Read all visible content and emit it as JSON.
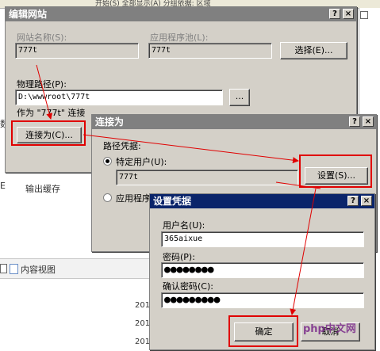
{
  "background": {
    "toolbar_text": "开始(S)   全部显示(A)  分组依据: 区域",
    "left_fragment": "数",
    "left_fragment2": "E",
    "actions_fragment": "输出缓存",
    "content_view": "内容视图",
    "dates": [
      "201",
      "201",
      "201"
    ]
  },
  "edit_site": {
    "title": "编辑网站",
    "help": "?",
    "close": "×",
    "site_name_label": "网站名称(S):",
    "site_name_value": "777t",
    "app_pool_label": "应用程序池(L):",
    "app_pool_value": "777t",
    "select_button": "选择(E)...",
    "physical_path_label": "物理路径(P):",
    "physical_path_value": "D:\\wwwroot\\777t",
    "browse_button": "...",
    "connect_as_caption": "作为 \"777t\" 连接",
    "connect_as_button": "连接为(C)..."
  },
  "connect_as": {
    "title": "连接为",
    "help": "?",
    "close": "×",
    "path_credentials_label": "路径凭据:",
    "specific_user_label": "特定用户(U):",
    "specific_user_value": "777t",
    "settings_button": "设置(S)...",
    "app_user_label": "应用程序"
  },
  "set_credentials": {
    "title": "设置凭据",
    "help": "?",
    "close": "×",
    "username_label": "用户名(U):",
    "username_value": "365aixue",
    "password_label": "密码(P):",
    "password_value": "●●●●●●●●",
    "confirm_label": "确认密码(C):",
    "confirm_value": "●●●●●●●●●",
    "ok_button": "确定",
    "cancel_button": "取消"
  },
  "watermark": "php中文网",
  "colors": {
    "annotation_red": "#e00000",
    "title_active": "#0a246a",
    "title_inactive": "#808080",
    "dialog_face": "#d4d0c8"
  }
}
